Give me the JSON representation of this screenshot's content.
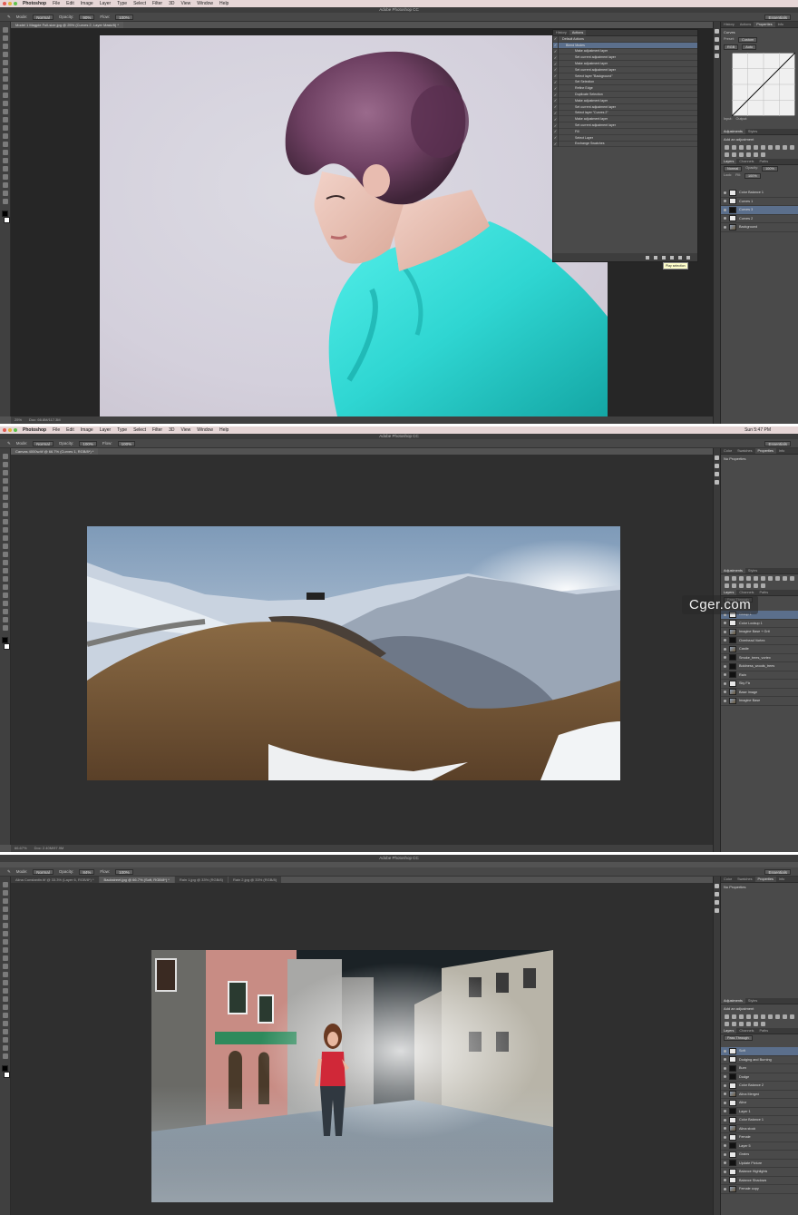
{
  "menubar": {
    "app": "Photoshop",
    "items": [
      "File",
      "Edit",
      "Image",
      "Layer",
      "Type",
      "Select",
      "Filter",
      "3D",
      "View",
      "Window",
      "Help"
    ]
  },
  "app_title": "Adobe Photoshop CC",
  "workspace_label": "Essentials",
  "shot1": {
    "doc_tab": "Model 1 Magpie Full-size.jpg @ 25% (Curves 2, Layer Mask/8) *",
    "options": {
      "mode_label": "Mode:",
      "mode_value": "Normal",
      "opacity_label": "Opacity:",
      "opacity_value": "90%",
      "flow_label": "Flow:",
      "flow_value": "100%"
    },
    "status": "25%",
    "status_doc": "Doc: 66.8M/117.3M",
    "actions_panel": {
      "tabs": [
        "History",
        "Actions"
      ],
      "rows": [
        "Default Actions",
        "Blend Modes",
        "Make adjustment layer",
        "Set current adjustment layer",
        "Make adjustment layer",
        "Set current adjustment layer",
        "Select layer \"Background\"",
        "Set Selection",
        "Refine Edge",
        "Duplicate Selection",
        "Make adjustment layer",
        "Set current adjustment layer",
        "Select layer \"Curves 2\"",
        "Make adjustment layer",
        "Set current adjustment layer",
        "Fill",
        "Select Layer",
        "Exchange Swatches"
      ]
    },
    "tooltip": "Play selection",
    "properties": {
      "tabs": [
        "History",
        "Actions",
        "Properties",
        "Info"
      ],
      "title": "Curves",
      "preset_label": "Preset:",
      "preset_value": "Custom",
      "channel_value": "RGB",
      "auto_label": "Auto",
      "input_label": "Input:",
      "output_label": "Output:"
    },
    "adjustments": {
      "tabs": [
        "Adjustments",
        "Styles"
      ],
      "title": "Add an adjustment"
    },
    "layers": {
      "tabs": [
        "Layers",
        "Channels",
        "Paths"
      ],
      "blend": "Normal",
      "opacity_label": "Opacity:",
      "opacity": "100%",
      "fill_label": "Fill:",
      "fill": "100%",
      "lock_label": "Lock:",
      "items": [
        {
          "name": "Color Balance 1",
          "thumb": "light",
          "selected": false
        },
        {
          "name": "Curves 1",
          "thumb": "light",
          "selected": false
        },
        {
          "name": "Curves 3",
          "thumb": "dark",
          "selected": true
        },
        {
          "name": "Curves 2",
          "thumb": "light",
          "selected": false
        },
        {
          "name": "Background",
          "thumb": "photo",
          "selected": false
        }
      ]
    }
  },
  "shot2": {
    "doc_tab": "Canvas 4000w.tif @ 66.7% (Curves 1, RGB/8*) *",
    "clock": "Sun 5:47 PM",
    "options": {
      "mode_label": "Mode:",
      "mode_value": "Normal",
      "opacity_label": "Opacity:",
      "opacity_value": "100%",
      "flow_label": "Flow:",
      "flow_value": "100%"
    },
    "status": "66.67%",
    "status_doc": "Doc: 2.40M/97.9M",
    "properties": {
      "tabs": [
        "Color",
        "Swatches",
        "Properties",
        "Info"
      ],
      "title": "No Properties"
    },
    "adjustments": {
      "tabs": [
        "Adjustments",
        "Styles"
      ]
    },
    "layers": {
      "tabs": [
        "Layers",
        "Channels",
        "Paths"
      ],
      "blend": "Pass Through",
      "items": [
        {
          "name": "Group 1",
          "thumb": "light",
          "selected": true
        },
        {
          "name": "Color Lookup 1",
          "thumb": "light",
          "selected": false
        },
        {
          "name": "Imagine Base + Grit",
          "thumb": "photo",
          "selected": false
        },
        {
          "name": "Overhead Vortex",
          "thumb": "dark",
          "selected": false
        },
        {
          "name": "Castle",
          "thumb": "photo",
          "selected": false
        },
        {
          "name": "Smoke_trees_vortex",
          "thumb": "dark",
          "selected": false
        },
        {
          "name": "Boldness_woods_trees",
          "thumb": "dark",
          "selected": false
        },
        {
          "name": "Rain",
          "thumb": "dark",
          "selected": false
        },
        {
          "name": "Sky Fix",
          "thumb": "light",
          "selected": false
        },
        {
          "name": "Base Image",
          "thumb": "photo",
          "selected": false
        },
        {
          "name": "Imagine Base",
          "thumb": "photo",
          "selected": false
        }
      ]
    },
    "watermark": "Cger.com"
  },
  "shot3": {
    "doc_tabs": [
      {
        "label": "Alina Constantin.tif @ 33.3% (Layer 6, RGB/8*) *",
        "active": false
      },
      {
        "label": "Backstreet.jpg @ 66.7% (Soft, RGB/8*) *",
        "active": true
      },
      {
        "label": "Rain 1.jpg @ 33% (RGB/8)",
        "active": false
      },
      {
        "label": "Rain 2.jpg @ 33% (RGB/8)",
        "active": false
      }
    ],
    "options": {
      "mode_label": "Mode:",
      "mode_value": "Normal",
      "opacity_label": "Opacity:",
      "opacity_value": "84%",
      "flow_label": "Flow:",
      "flow_value": "100%"
    },
    "properties": {
      "tabs": [
        "Color",
        "Swatches",
        "Properties",
        "Info"
      ],
      "title": "No Properties"
    },
    "adjustments": {
      "tabs": [
        "Adjustments",
        "Styles"
      ],
      "title": "Add an adjustment"
    },
    "layers": {
      "tabs": [
        "Layers",
        "Channels",
        "Paths"
      ],
      "blend": "Pass Through",
      "items": [
        {
          "name": "Soft",
          "thumb": "light",
          "selected": true
        },
        {
          "name": "Dodging and Burning",
          "thumb": "light",
          "selected": false
        },
        {
          "name": "Burn",
          "thumb": "dark",
          "selected": false
        },
        {
          "name": "Dodge",
          "thumb": "dark",
          "selected": false
        },
        {
          "name": "Color Balance 2",
          "thumb": "light",
          "selected": false
        },
        {
          "name": "Alina Merged",
          "thumb": "photo",
          "selected": false
        },
        {
          "name": "Alina",
          "thumb": "light",
          "selected": false
        },
        {
          "name": "Layer 1",
          "thumb": "dark",
          "selected": false
        },
        {
          "name": "Color Balance 1",
          "thumb": "light",
          "selected": false
        },
        {
          "name": "Alina stock",
          "thumb": "photo",
          "selected": false
        },
        {
          "name": "Female",
          "thumb": "light",
          "selected": false
        },
        {
          "name": "Layer 5",
          "thumb": "dark",
          "selected": false
        },
        {
          "name": "Grains",
          "thumb": "light",
          "selected": false
        },
        {
          "name": "Update Picture",
          "thumb": "dark",
          "selected": false
        },
        {
          "name": "Balance Highlights",
          "thumb": "light",
          "selected": false
        },
        {
          "name": "Balance Shadows",
          "thumb": "light",
          "selected": false
        },
        {
          "name": "Female copy",
          "thumb": "photo",
          "selected": false
        }
      ]
    }
  },
  "colors": {
    "ps_dark": "#535353",
    "canvas_bg": "#2f2f2f",
    "selection": "#5b6f8c",
    "shirt_teal": "#2fd6d2",
    "shirt_red": "#d02838"
  }
}
